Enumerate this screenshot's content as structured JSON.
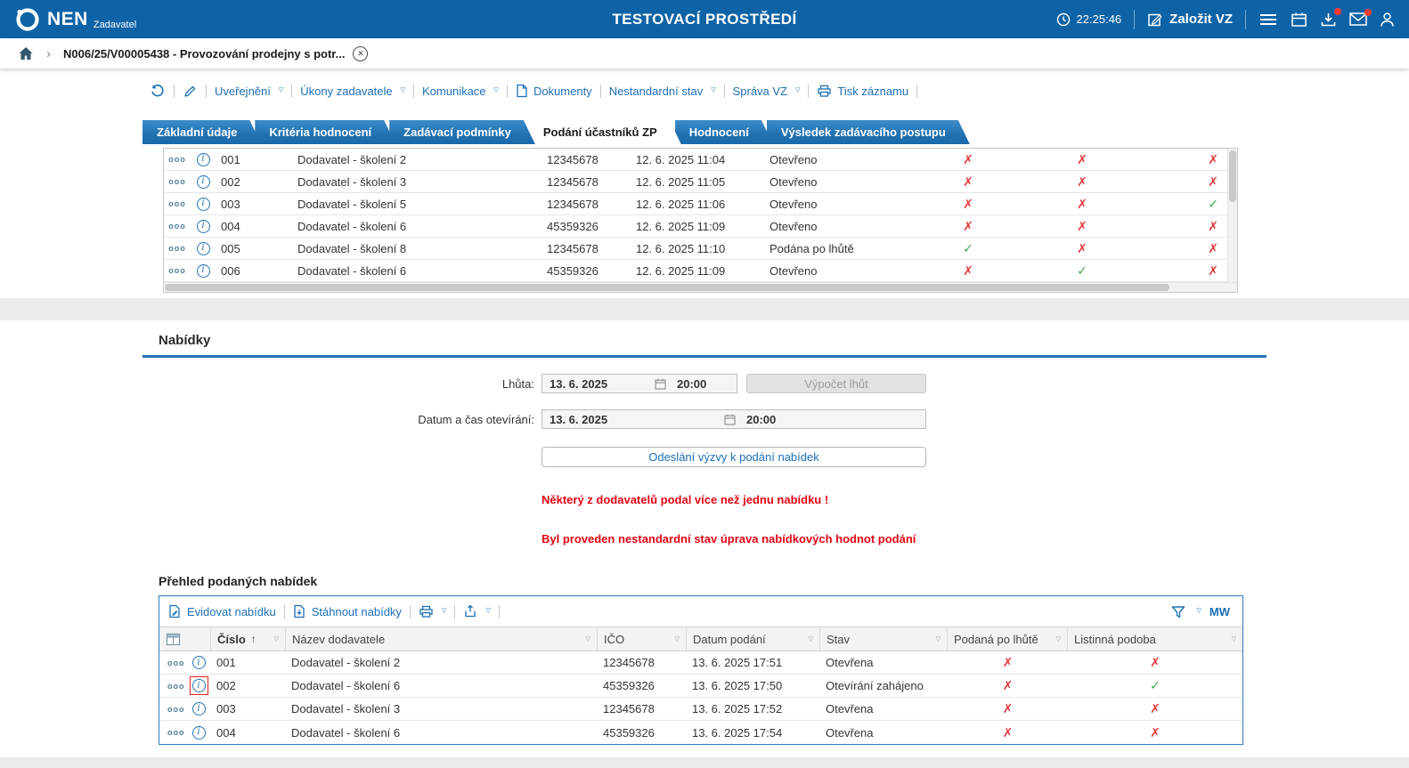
{
  "icons": {
    "dropdown": "▽",
    "sort_asc": "↑",
    "chevron": "›",
    "overflow": "ooo",
    "info": "i",
    "close": "✕"
  },
  "topbar": {
    "logo": "NEN",
    "logo_sub": "Zadavatel",
    "env_title": "TESTOVACÍ PROSTŘEDÍ",
    "time": "22:25:46",
    "create_vz": "Založit VZ"
  },
  "breadcrumb": {
    "crumb": "N006/25/V00005438 - Provozování prodejny s potr..."
  },
  "record_toolbar": {
    "items": [
      {
        "label": "Uveřejnění"
      },
      {
        "label": "Úkony zadavatele"
      },
      {
        "label": "Komunikace"
      },
      {
        "label": "Dokumenty"
      },
      {
        "label": "Nestandardní stav"
      },
      {
        "label": "Správa VZ"
      },
      {
        "label": "Tisk záznamu"
      }
    ]
  },
  "tabs": [
    {
      "label": "Základní údaje",
      "active": false
    },
    {
      "label": "Kritéria hodnocení",
      "active": false
    },
    {
      "label": "Zadávací podmínky",
      "active": false
    },
    {
      "label": "Podání účastníků ZP",
      "active": true
    },
    {
      "label": "Hodnocení",
      "active": false
    },
    {
      "label": "Výsledek zadávacího postupu",
      "active": false
    }
  ],
  "participants": {
    "rows": [
      {
        "num": "001",
        "supplier": "Dodavatel - školení 2",
        "ico": "12345678",
        "date": "12. 6. 2025 11:04",
        "status": "Otevřeno",
        "marks": [
          {
            "glyph": "✗",
            "color": "red"
          },
          {
            "glyph": "✗",
            "color": "red"
          },
          {
            "glyph": "✗",
            "color": "red"
          }
        ]
      },
      {
        "num": "002",
        "supplier": "Dodavatel - školení 3",
        "ico": "12345678",
        "date": "12. 6. 2025 11:05",
        "status": "Otevřeno",
        "marks": [
          {
            "glyph": "✗",
            "color": "red"
          },
          {
            "glyph": "✗",
            "color": "red"
          },
          {
            "glyph": "✗",
            "color": "red"
          }
        ]
      },
      {
        "num": "003",
        "supplier": "Dodavatel - školení 5",
        "ico": "12345678",
        "date": "12. 6. 2025 11:06",
        "status": "Otevřeno",
        "marks": [
          {
            "glyph": "✗",
            "color": "red"
          },
          {
            "glyph": "✗",
            "color": "red"
          },
          {
            "glyph": "✓",
            "color": "green"
          }
        ]
      },
      {
        "num": "004",
        "supplier": "Dodavatel - školení 6",
        "ico": "45359326",
        "date": "12. 6. 2025 11:09",
        "status": "Otevřeno",
        "marks": [
          {
            "glyph": "✗",
            "color": "red"
          },
          {
            "glyph": "✗",
            "color": "red"
          },
          {
            "glyph": "✗",
            "color": "red"
          }
        ]
      },
      {
        "num": "005",
        "supplier": "Dodavatel - školení 8",
        "ico": "12345678",
        "date": "12. 6. 2025 11:10",
        "status": "Podána po lhůtě",
        "marks": [
          {
            "glyph": "✓",
            "color": "green"
          },
          {
            "glyph": "✗",
            "color": "red"
          },
          {
            "glyph": "✗",
            "color": "red"
          }
        ]
      },
      {
        "num": "006",
        "supplier": "Dodavatel - školení 6",
        "ico": "45359326",
        "date": "12. 6. 2025 11:09",
        "status": "Otevřeno",
        "marks": [
          {
            "glyph": "✗",
            "color": "red"
          },
          {
            "glyph": "✓",
            "color": "green"
          },
          {
            "glyph": "✗",
            "color": "red"
          }
        ]
      }
    ]
  },
  "offers": {
    "title": "Nabídky",
    "deadline_label": "Lhůta:",
    "deadline_date": "13. 6. 2025",
    "deadline_time": "20:00",
    "calc_button": "Výpočet lhůt",
    "opening_label": "Datum a čas otevírání:",
    "opening_date": "13. 6. 2025",
    "opening_time": "20:00",
    "send_button": "Odeslání výzvy k podání nabídek",
    "warning1": "Některý z dodavatelů podal více než jednu nabídku !",
    "warning2": "Byl proveden nestandardní stav úprava nabídkových hodnot podání"
  },
  "offers_panel": {
    "title": "Přehled podaných nabídek",
    "toolbar": {
      "register": "Evidovat nabídku",
      "download": "Stáhnout nabídky",
      "view": "MW"
    },
    "headers": {
      "number": "Číslo",
      "supplier": "Název dodavatele",
      "ico": "IČO",
      "date": "Datum podání",
      "status": "Stav",
      "late": "Podaná po lhůtě",
      "paper": "Listinná podoba"
    },
    "rows": [
      {
        "num": "001",
        "supplier": "Dodavatel - školení 2",
        "ico": "12345678",
        "date": "13. 6. 2025 17:51",
        "status": "Otevřena",
        "late": {
          "glyph": "✗",
          "color": "red"
        },
        "paper": {
          "glyph": "✗",
          "color": "red"
        },
        "highlight": false
      },
      {
        "num": "002",
        "supplier": "Dodavatel - školení 6",
        "ico": "45359326",
        "date": "13. 6. 2025 17:50",
        "status": "Otevírání zahájeno",
        "late": {
          "glyph": "✗",
          "color": "red"
        },
        "paper": {
          "glyph": "✓",
          "color": "green"
        },
        "highlight": true
      },
      {
        "num": "003",
        "supplier": "Dodavatel - školení 3",
        "ico": "12345678",
        "date": "13. 6. 2025 17:52",
        "status": "Otevřena",
        "late": {
          "glyph": "✗",
          "color": "red"
        },
        "paper": {
          "glyph": "✗",
          "color": "red"
        },
        "highlight": false
      },
      {
        "num": "004",
        "supplier": "Dodavatel - školení 6",
        "ico": "45359326",
        "date": "13. 6. 2025 17:54",
        "status": "Otevřena",
        "late": {
          "glyph": "✗",
          "color": "red"
        },
        "paper": {
          "glyph": "✗",
          "color": "red"
        },
        "highlight": false
      }
    ]
  }
}
